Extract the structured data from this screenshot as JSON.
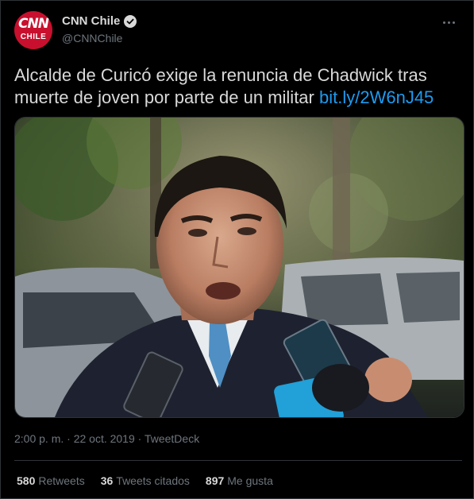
{
  "author": {
    "avatar_top": "CNN",
    "avatar_bottom": "CHILE",
    "display_name": "CNN Chile",
    "handle": "@CNNChile",
    "verified": true
  },
  "tweet": {
    "text": "Alcalde de Curicó exige la renuncia de Chadwick tras muerte de joven por parte de un militar",
    "link": "bit.ly/2W6nJ45",
    "timestamp": "2:00 p. m. · 22 oct. 2019 · TweetDeck"
  },
  "stats": {
    "retweets_count": "580",
    "retweets_label": "Retweets",
    "quotes_count": "36",
    "quotes_label": "Tweets citados",
    "likes_count": "897",
    "likes_label": "Me gusta"
  },
  "icons": {
    "more": "more-horizontal-icon",
    "verified": "verified-badge-icon"
  },
  "colors": {
    "background": "#000000",
    "link": "#1d9bf0",
    "muted": "#6e767d",
    "brand": "#c8102e"
  }
}
